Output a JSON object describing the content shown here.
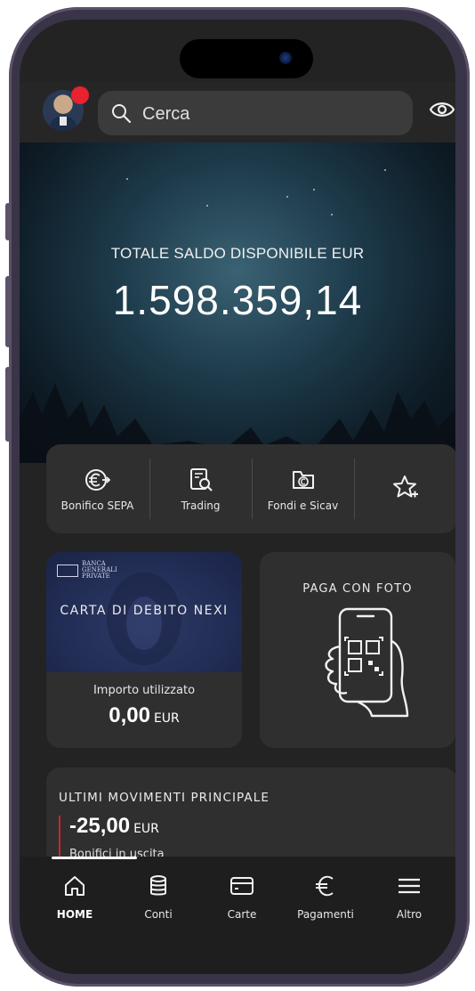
{
  "header": {
    "search_placeholder": "Cerca"
  },
  "balance": {
    "label": "TOTALE SALDO DISPONIBILE EUR",
    "value": "1.598.359,14"
  },
  "quick_actions": [
    {
      "label": "Bonifico SEPA",
      "icon": "euro-transfer-icon"
    },
    {
      "label": "Trading",
      "icon": "trading-document-icon"
    },
    {
      "label": "Fondi e Sicav",
      "icon": "fund-folder-icon"
    },
    {
      "label": "",
      "icon": "star-add-icon"
    }
  ],
  "debit_card": {
    "title": "CARTA DI DEBITO NEXI",
    "logo_text": "BANCA GENERALI PRIVATE",
    "used_label": "Importo utilizzato",
    "used_value": "0,00",
    "used_currency": "EUR"
  },
  "photo_pay": {
    "title": "PAGA CON FOTO"
  },
  "movements": {
    "title": "ULTIMI MOVIMENTI PRINCIPALE",
    "amount": "-25,00",
    "currency": "EUR",
    "description": "Bonifici in uscita"
  },
  "nav": [
    {
      "label": "HOME",
      "icon": "home-icon",
      "active": true
    },
    {
      "label": "Conti",
      "icon": "coins-icon",
      "active": false
    },
    {
      "label": "Carte",
      "icon": "card-icon",
      "active": false
    },
    {
      "label": "Pagamenti",
      "icon": "euro-icon",
      "active": false
    },
    {
      "label": "Altro",
      "icon": "menu-icon",
      "active": false
    }
  ],
  "colors": {
    "background": "#232323",
    "card": "#2f2f2f",
    "notification": "#e8222e",
    "negative_bar": "#c62828"
  }
}
